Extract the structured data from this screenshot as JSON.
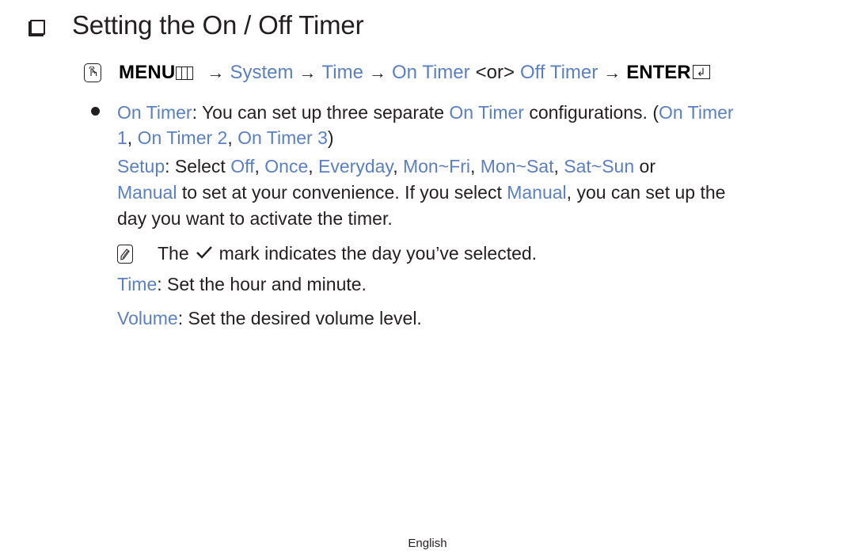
{
  "heading": {
    "icon": "checkbox-square-icon",
    "title": "Setting the On / Off Timer"
  },
  "menu_path": {
    "icon": "om-hand-icon",
    "menu_label": "MENU",
    "menu_icon": "menu-grid-icon",
    "arrow": "→",
    "items": [
      "System",
      "Time",
      "On Timer"
    ],
    "or_label": "<or>",
    "alt_item": "Off Timer",
    "enter_label": "ENTER",
    "enter_icon": "enter-return-icon",
    "enter_glyph": "↲"
  },
  "on_timer": {
    "bullet_icon": "bullet-icon",
    "term": "On Timer",
    "text1": ": You can set up three separate ",
    "term2": "On Timer",
    "text2": " configurations. (",
    "term3a": "On Timer",
    "term3b": "1",
    "sep1": ", ",
    "term4": "On Timer 2",
    "sep2": ", ",
    "term5": "On Timer 3",
    "close": ")"
  },
  "setup": {
    "term": "Setup",
    "text1": ": Select ",
    "options": [
      "Off",
      "Once",
      "Everyday",
      "Mon~Fri",
      "Mon~Sat",
      "Sat~Sun"
    ],
    "sep": ", ",
    "or_text": " or",
    "manual": "Manual",
    "text2": " to set at your convenience. If you select ",
    "manual2": "Manual",
    "text3": ", you can set up the",
    "text4": "day you want to activate the timer."
  },
  "note": {
    "icon": "note-pencil-icon",
    "text1": "The",
    "check_icon": "checkmark-icon",
    "text2": "mark indicates the day you’ve selected."
  },
  "time": {
    "term": "Time",
    "text": ": Set the hour and minute."
  },
  "volume": {
    "term": "Volume",
    "text": ": Set the desired volume level."
  },
  "footer": {
    "language": "English"
  },
  "colors": {
    "highlight": "#5a7fc2",
    "text": "#231f20"
  }
}
